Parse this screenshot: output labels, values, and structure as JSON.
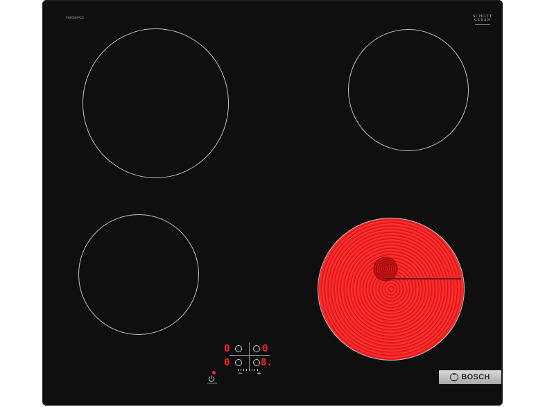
{
  "product": {
    "model_label": "PKE6NMA1E",
    "glass_brand_line1": "SCHOTT",
    "glass_brand_line2": "CERAN",
    "brand_name": "BOSCH"
  },
  "controls": {
    "left_top_display": "0",
    "right_top_display": "0",
    "left_bottom_display": "0",
    "right_bottom_display": "8.",
    "minus_label": "−",
    "plus_label": "+",
    "power_icon": "power-icon"
  },
  "zones": [
    {
      "id": "front-left",
      "active": false
    },
    {
      "id": "front-right",
      "active": false
    },
    {
      "id": "back-left",
      "active": false
    },
    {
      "id": "back-right",
      "active": true,
      "glow_color": "#ff1a1a"
    }
  ],
  "colors": {
    "glass": "#0f0f0f",
    "zone_outline": "#bfbfbf",
    "display_red": "#ff2424",
    "brand_plate": "#c0c0c0"
  }
}
